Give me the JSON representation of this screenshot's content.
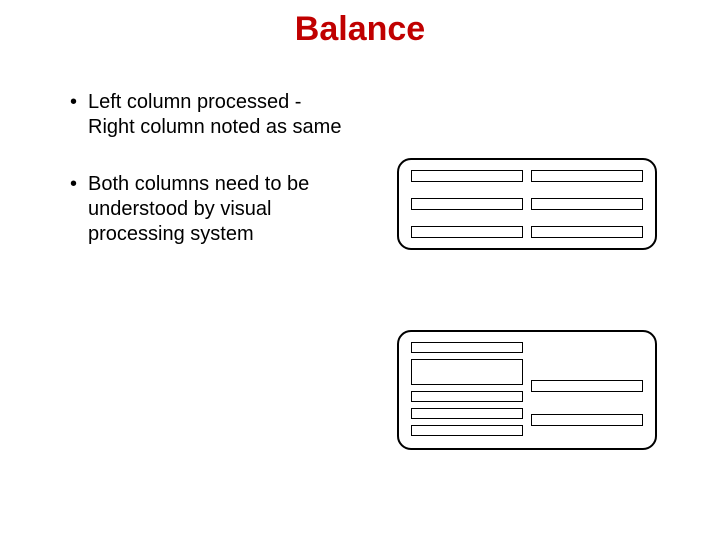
{
  "title": "Balance",
  "bullets": [
    "Left column processed - Right column noted as same",
    "Both columns need to be understood by visual processing system"
  ]
}
